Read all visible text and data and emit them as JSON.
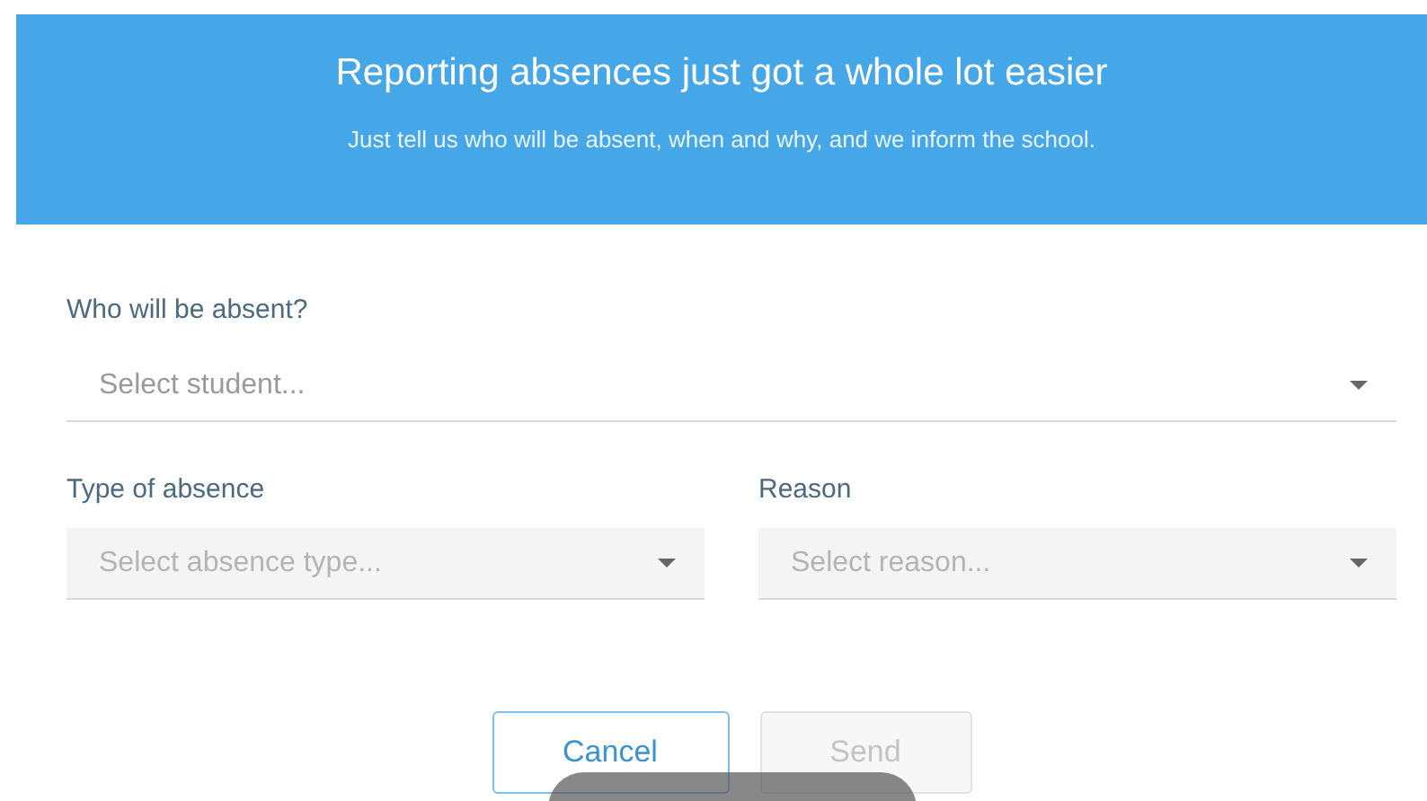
{
  "banner": {
    "title": "Reporting absences just got a whole lot easier",
    "subtitle": "Just tell us who will be absent, when and why, and we inform the school."
  },
  "student": {
    "label": "Who will be absent?",
    "placeholder": "Select student...",
    "disabled": false
  },
  "fields": [
    {
      "label": "Type of absence",
      "placeholder": "Select absence type...",
      "disabled": true
    },
    {
      "label": "Reason",
      "placeholder": "Select reason...",
      "disabled": true
    }
  ],
  "buttons": [
    {
      "label": "Cancel",
      "disabled": false
    },
    {
      "label": "Send",
      "disabled": true
    }
  ]
}
